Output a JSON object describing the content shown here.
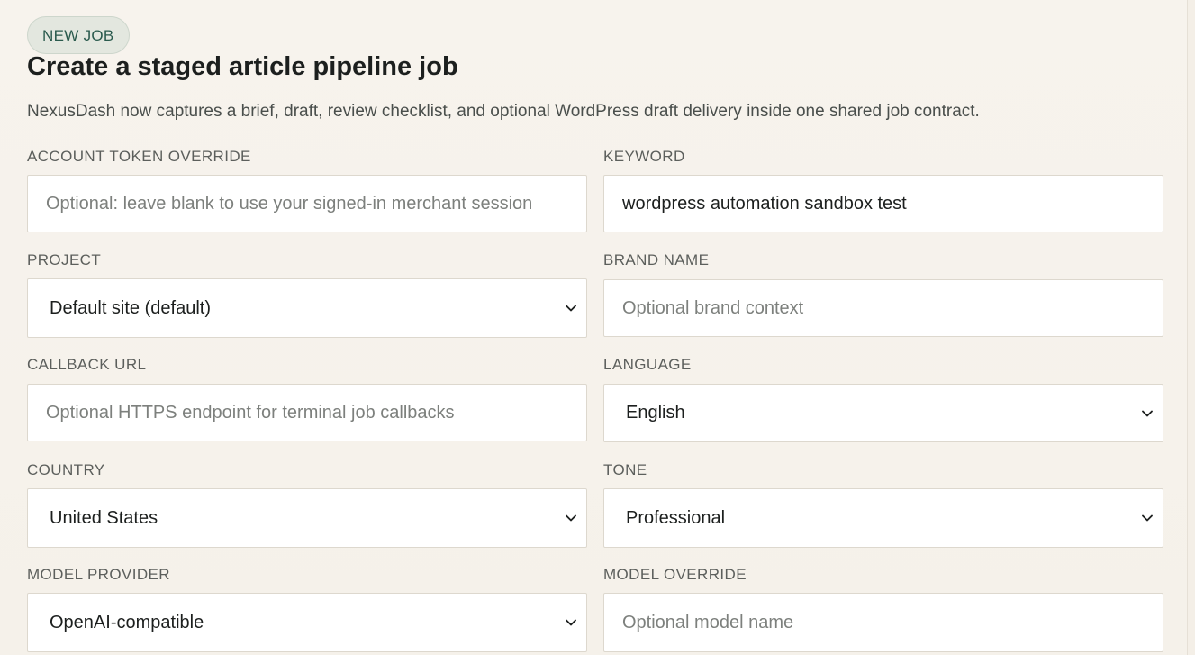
{
  "header": {
    "badge": "NEW JOB",
    "title": "Create a staged article pipeline job",
    "subtitle": "NexusDash now captures a brief, draft, review checklist, and optional WordPress draft delivery inside one shared job contract."
  },
  "form": {
    "account_token": {
      "label": "ACCOUNT TOKEN OVERRIDE",
      "value": "",
      "placeholder": "Optional: leave blank to use your signed-in merchant session"
    },
    "keyword": {
      "label": "KEYWORD",
      "value": "wordpress automation sandbox test",
      "placeholder": ""
    },
    "project": {
      "label": "PROJECT",
      "selected": "Default site (default)"
    },
    "brand_name": {
      "label": "BRAND NAME",
      "value": "",
      "placeholder": "Optional brand context"
    },
    "callback_url": {
      "label": "CALLBACK URL",
      "value": "",
      "placeholder": "Optional HTTPS endpoint for terminal job callbacks"
    },
    "language": {
      "label": "LANGUAGE",
      "selected": "English"
    },
    "country": {
      "label": "COUNTRY",
      "selected": "United States"
    },
    "tone": {
      "label": "TONE",
      "selected": "Professional"
    },
    "model_provider": {
      "label": "MODEL PROVIDER",
      "selected": "OpenAI-compatible"
    },
    "model_override": {
      "label": "MODEL OVERRIDE",
      "value": "",
      "placeholder": "Optional model name"
    }
  },
  "icons": {
    "select_arrow": "chevron-down-icon"
  },
  "colors": {
    "background": "#f4efe7",
    "badge_bg": "#e3e7df",
    "badge_text": "#2a5a4d",
    "title": "#1c1f1e",
    "label": "#5c5f5c",
    "field_bg": "#ffffff",
    "field_border": "#ddd8ce",
    "placeholder": "#7d807d"
  }
}
